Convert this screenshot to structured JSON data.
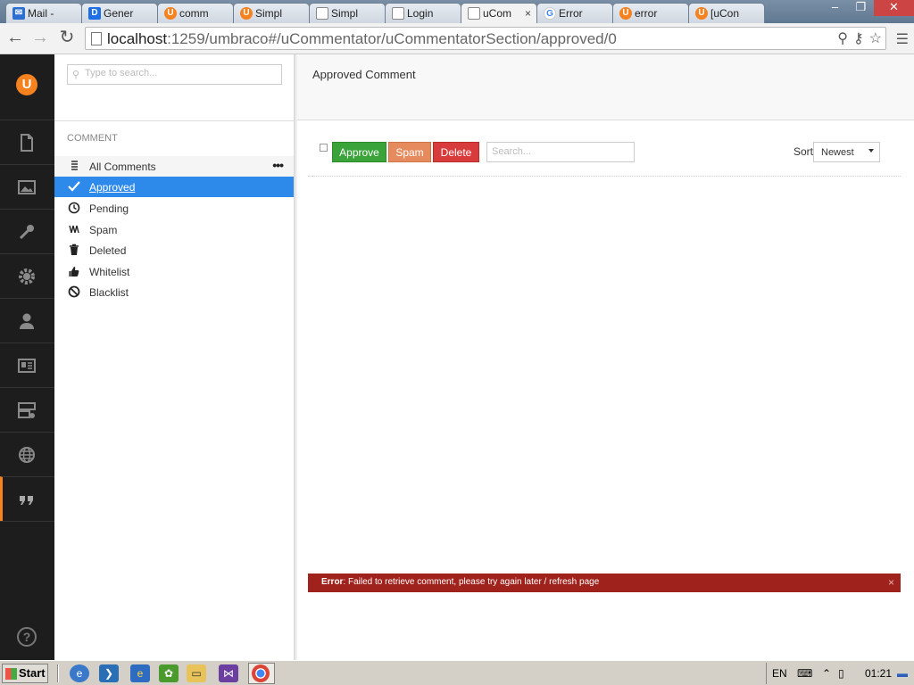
{
  "browser": {
    "tabs": [
      {
        "label": "Mail -",
        "favicon": "mail-icon",
        "active": false
      },
      {
        "label": "Gener",
        "favicon": "d-icon",
        "active": false
      },
      {
        "label": "comm",
        "favicon": "umbraco-icon",
        "active": false
      },
      {
        "label": "Simpl",
        "favicon": "umbraco-icon",
        "active": false
      },
      {
        "label": "Simpl",
        "favicon": "page-icon",
        "active": false
      },
      {
        "label": "Login",
        "favicon": "page-icon",
        "active": false
      },
      {
        "label": "uCom",
        "favicon": "page-icon",
        "active": true
      },
      {
        "label": "Error",
        "favicon": "google-icon",
        "active": false
      },
      {
        "label": "error",
        "favicon": "umbraco-icon",
        "active": false
      },
      {
        "label": "[uCon",
        "favicon": "umbraco-icon",
        "active": false
      }
    ],
    "tab_close": "×",
    "url_host": "localhost",
    "url_rest": ":1259/umbraco#/uCommentator/uCommentatorSection/approved/0"
  },
  "sections": {
    "logo": "U",
    "items": [
      "content-icon",
      "media-icon",
      "developer-icon",
      "settings-icon",
      "users-icon",
      "members-icon",
      "forms-icon",
      "translation-icon",
      "ucommentator-icon"
    ],
    "active": "ucommentator-icon",
    "help": "?"
  },
  "tree": {
    "search_placeholder": "Type to search...",
    "title": "COMMENT",
    "root_label": "All Comments",
    "items": [
      {
        "label": "Approved",
        "icon": "check-icon",
        "selected": true
      },
      {
        "label": "Pending",
        "icon": "clock-icon",
        "selected": false
      },
      {
        "label": "Spam",
        "icon": "spam-icon",
        "selected": false
      },
      {
        "label": "Deleted",
        "icon": "trash-icon",
        "selected": false
      },
      {
        "label": "Whitelist",
        "icon": "thumbs-up-icon",
        "selected": false
      },
      {
        "label": "Blacklist",
        "icon": "block-icon",
        "selected": false
      }
    ]
  },
  "main": {
    "title": "Approved Comment",
    "approve_label": "Approve",
    "spam_label": "Spam",
    "delete_label": "Delete",
    "search_placeholder": "Search...",
    "sort_label": "Sort",
    "sort_value": "Newest",
    "error_prefix": "Error",
    "error_message": ": Failed to retrieve comment, please try again later / refresh page",
    "error_close": "×"
  },
  "taskbar": {
    "start_label": "Start",
    "language": "EN",
    "clock": "01:21"
  },
  "colors": {
    "accent": "#f5821f",
    "selected": "#2e8aea",
    "approve": "#3aa33a",
    "spam": "#e58b5e",
    "delete": "#d73b3b",
    "error": "#a0221c"
  }
}
